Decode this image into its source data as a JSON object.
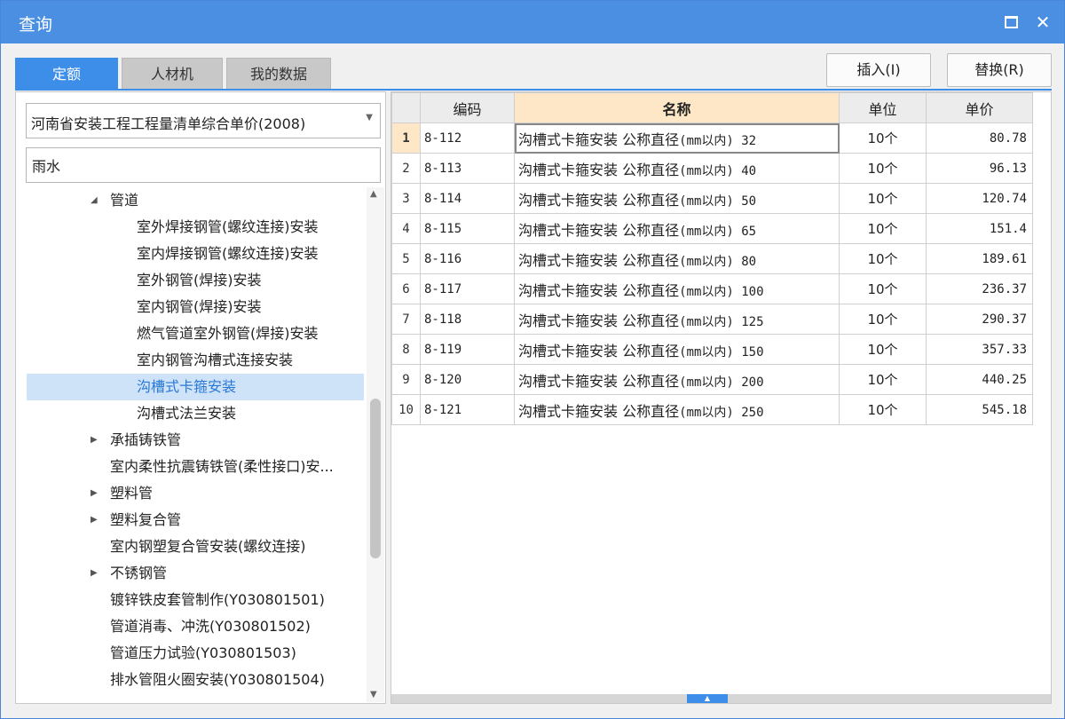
{
  "window": {
    "title": "查询"
  },
  "tabs": [
    {
      "label": "定额",
      "active": true
    },
    {
      "label": "人材机",
      "active": false
    },
    {
      "label": "我的数据",
      "active": false
    }
  ],
  "actions": {
    "insert": "插入(I)",
    "replace": "替换(R)"
  },
  "library": {
    "selected": "河南省安装工程工程量清单综合单价(2008)"
  },
  "search": {
    "value": "雨水",
    "placeholder": ""
  },
  "tree": [
    {
      "label": "管道",
      "level": 1,
      "toggle": "expanded"
    },
    {
      "label": "室外焊接钢管(螺纹连接)安装",
      "level": 2
    },
    {
      "label": "室内焊接钢管(螺纹连接)安装",
      "level": 2
    },
    {
      "label": "室外钢管(焊接)安装",
      "level": 2
    },
    {
      "label": "室内钢管(焊接)安装",
      "level": 2
    },
    {
      "label": "燃气管道室外钢管(焊接)安装",
      "level": 2
    },
    {
      "label": "室内钢管沟槽式连接安装",
      "level": 2
    },
    {
      "label": "沟槽式卡箍安装",
      "level": 2,
      "selected": true
    },
    {
      "label": "沟槽式法兰安装",
      "level": 2
    },
    {
      "label": "承插铸铁管",
      "level": 1,
      "toggle": "collapsed"
    },
    {
      "label": "室内柔性抗震铸铁管(柔性接口)安...",
      "level": 1
    },
    {
      "label": "塑料管",
      "level": 1,
      "toggle": "collapsed"
    },
    {
      "label": "塑料复合管",
      "level": 1,
      "toggle": "collapsed"
    },
    {
      "label": "室内钢塑复合管安装(螺纹连接)",
      "level": 1
    },
    {
      "label": "不锈钢管",
      "level": 1,
      "toggle": "collapsed"
    },
    {
      "label": "镀锌铁皮套管制作(Y030801501)",
      "level": 1
    },
    {
      "label": "管道消毒、冲洗(Y030801502)",
      "level": 1
    },
    {
      "label": "管道压力试验(Y030801503)",
      "level": 1
    },
    {
      "label": "排水管阻火圈安装(Y030801504)",
      "level": 1
    }
  ],
  "grid": {
    "headers": {
      "code": "编码",
      "name": "名称",
      "unit": "单位",
      "price": "单价"
    },
    "rows": [
      {
        "no": "1",
        "code": "8-112",
        "name_cn": "沟槽式卡箍安装 公称直径",
        "name_spec": "(mm以内) 32",
        "unit": "10个",
        "price": "80.78"
      },
      {
        "no": "2",
        "code": "8-113",
        "name_cn": "沟槽式卡箍安装 公称直径",
        "name_spec": "(mm以内) 40",
        "unit": "10个",
        "price": "96.13"
      },
      {
        "no": "3",
        "code": "8-114",
        "name_cn": "沟槽式卡箍安装 公称直径",
        "name_spec": "(mm以内) 50",
        "unit": "10个",
        "price": "120.74"
      },
      {
        "no": "4",
        "code": "8-115",
        "name_cn": "沟槽式卡箍安装 公称直径",
        "name_spec": "(mm以内) 65",
        "unit": "10个",
        "price": "151.4"
      },
      {
        "no": "5",
        "code": "8-116",
        "name_cn": "沟槽式卡箍安装 公称直径",
        "name_spec": "(mm以内) 80",
        "unit": "10个",
        "price": "189.61"
      },
      {
        "no": "6",
        "code": "8-117",
        "name_cn": "沟槽式卡箍安装 公称直径",
        "name_spec": "(mm以内) 100",
        "unit": "10个",
        "price": "236.37"
      },
      {
        "no": "7",
        "code": "8-118",
        "name_cn": "沟槽式卡箍安装 公称直径",
        "name_spec": "(mm以内) 125",
        "unit": "10个",
        "price": "290.37"
      },
      {
        "no": "8",
        "code": "8-119",
        "name_cn": "沟槽式卡箍安装 公称直径",
        "name_spec": "(mm以内) 150",
        "unit": "10个",
        "price": "357.33"
      },
      {
        "no": "9",
        "code": "8-120",
        "name_cn": "沟槽式卡箍安装 公称直径",
        "name_spec": "(mm以内) 200",
        "unit": "10个",
        "price": "440.25"
      },
      {
        "no": "10",
        "code": "8-121",
        "name_cn": "沟槽式卡箍安装 公称直径",
        "name_spec": "(mm以内) 250",
        "unit": "10个",
        "price": "545.18"
      }
    ]
  },
  "icons": {
    "maximize": "maximize-icon",
    "close": "close-icon",
    "dropdown": "chevron-down-icon"
  },
  "colors": {
    "titlebar": "#4a8fe2",
    "accent": "#3d8ee9",
    "selection": "#cfe3f8",
    "header_highlight": "#fde7c6"
  }
}
